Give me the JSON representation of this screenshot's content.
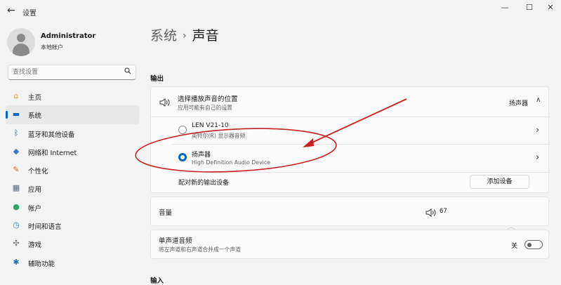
{
  "window": {
    "title": "设置",
    "back_glyph": "←",
    "minimize": "—",
    "maximize": "☐",
    "close": "✕"
  },
  "user": {
    "name": "Administrator",
    "account_type": "本地帐户"
  },
  "search": {
    "placeholder": "查找设置",
    "icon": "search-icon"
  },
  "nav": [
    {
      "label": "主页",
      "icon": "home-icon",
      "glyph": "⌂",
      "color": "#e8a135"
    },
    {
      "label": "系统",
      "icon": "system-icon",
      "glyph": "▬",
      "color": "#0067c0",
      "active": true
    },
    {
      "label": "蓝牙和其他设备",
      "icon": "bluetooth-icon",
      "glyph": "ᛒ",
      "color": "#0067c0"
    },
    {
      "label": "网络和 Internet",
      "icon": "wifi-icon",
      "glyph": "◆",
      "color": "#2d7dd2"
    },
    {
      "label": "个性化",
      "icon": "brush-icon",
      "glyph": "✎",
      "color": "#c26a28"
    },
    {
      "label": "应用",
      "icon": "apps-icon",
      "glyph": "▦",
      "color": "#4a6a8a"
    },
    {
      "label": "帐户",
      "icon": "account-icon",
      "glyph": "●",
      "color": "#2aa56d"
    },
    {
      "label": "时间和语言",
      "icon": "clock-globe-icon",
      "glyph": "◷",
      "color": "#2d7dd2"
    },
    {
      "label": "游戏",
      "icon": "gamepad-icon",
      "glyph": "✣",
      "color": "#6b6b6b"
    },
    {
      "label": "辅助功能",
      "icon": "accessibility-icon",
      "glyph": "✱",
      "color": "#1f6fb5"
    }
  ],
  "breadcrumb": {
    "parent": "系统",
    "separator": "›",
    "current": "声音"
  },
  "output": {
    "heading": "输出",
    "choose": {
      "title": "选择播放声音的位置",
      "subtitle": "应用可能有自己的设置",
      "selected": "扬声器",
      "icon": "speaker-icon",
      "chevron": "∧"
    },
    "devices": [
      {
        "name": "LEN V21-10",
        "desc": "英特尔(R) 显示器音频",
        "selected": false,
        "chevron": "›"
      },
      {
        "name": "扬声器",
        "desc": "High Definition Audio Device",
        "selected": true,
        "chevron": "›"
      }
    ],
    "pair": {
      "label": "配对新的输出设备",
      "button": "添加设备"
    },
    "volume": {
      "label": "音量",
      "value": 67,
      "icon": "volume-icon"
    },
    "mono": {
      "title": "单声道音频",
      "subtitle": "将左声道和右声道合并成一个声道",
      "state": "关",
      "on": false
    }
  },
  "input": {
    "heading": "输入"
  },
  "annotation": {
    "stroke": "#cc2020"
  }
}
